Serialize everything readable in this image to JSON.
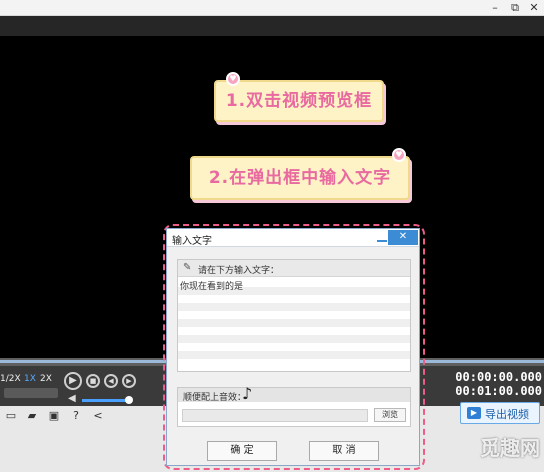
{
  "window_controls": {
    "minimize": "–",
    "maximize": "⧉",
    "close": "✕"
  },
  "stickers": {
    "step1": "1.双击视频预览框",
    "step2": "2.在弹出框中输入文字"
  },
  "player": {
    "speeds": [
      "1/2X",
      "1X",
      "2X"
    ],
    "active_speed": "1X",
    "progress": 1.0,
    "volume": 0.9,
    "time_current": "00:00:00.000",
    "time_total": "00:01:00.000"
  },
  "bottom": {
    "export_label": "导出视频"
  },
  "dialog": {
    "title": "输入文字",
    "close": "✕",
    "prompt": "请在下方输入文字：",
    "text_value": "你现在看到的是",
    "audio_label": "顺便配上音效：",
    "browse": "浏览",
    "ok": "确  定",
    "cancel": "取  消"
  },
  "watermark": "觅趣网",
  "colors": {
    "accent": "#3c8cd5",
    "sticker_text": "#e86aa0",
    "dash": "#ee5d88"
  }
}
